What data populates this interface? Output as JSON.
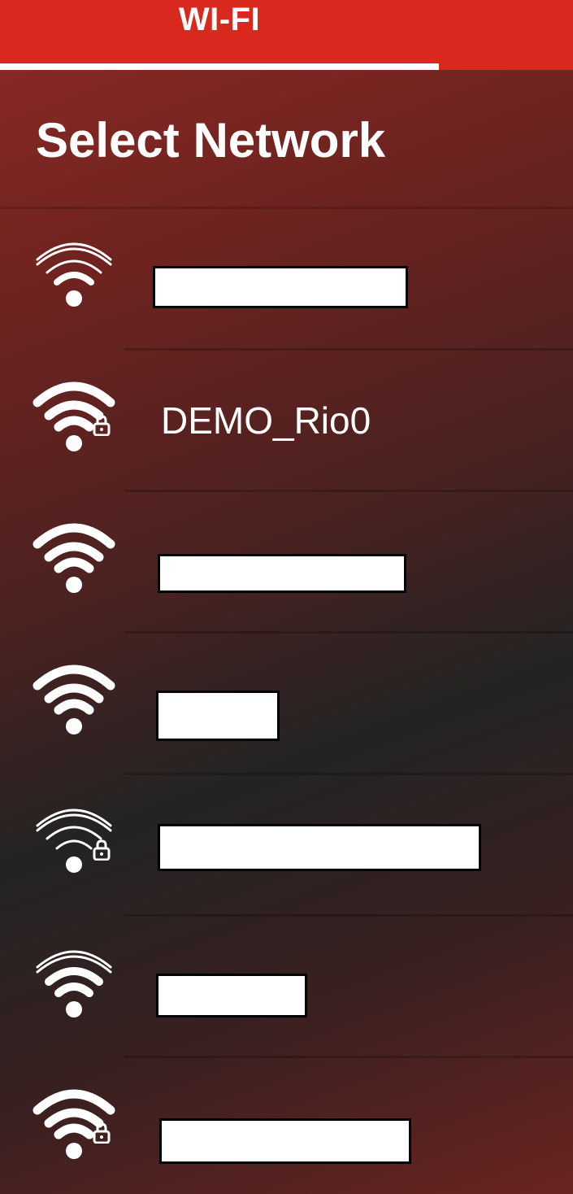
{
  "tab": {
    "label": "WI-FI"
  },
  "header": {
    "title": "Select Network"
  },
  "networks": [
    {
      "ssid": "",
      "redacted": true,
      "secured": false,
      "signal_bars": 1
    },
    {
      "ssid": "DEMO_Rio0",
      "redacted": false,
      "secured": true,
      "signal_bars": 4
    },
    {
      "ssid": "",
      "redacted": true,
      "secured": false,
      "signal_bars": 4
    },
    {
      "ssid": "",
      "redacted": true,
      "secured": false,
      "signal_bars": 4
    },
    {
      "ssid": "",
      "redacted": true,
      "secured": true,
      "signal_bars": 1
    },
    {
      "ssid": "",
      "redacted": true,
      "secured": false,
      "signal_bars": 2
    },
    {
      "ssid": "",
      "redacted": true,
      "secured": true,
      "signal_bars": 4
    }
  ],
  "icons": {
    "wifi": "wifi-icon",
    "lock": "lock-icon"
  },
  "colors": {
    "accent": "#d9281e",
    "text": "#ffffff"
  }
}
